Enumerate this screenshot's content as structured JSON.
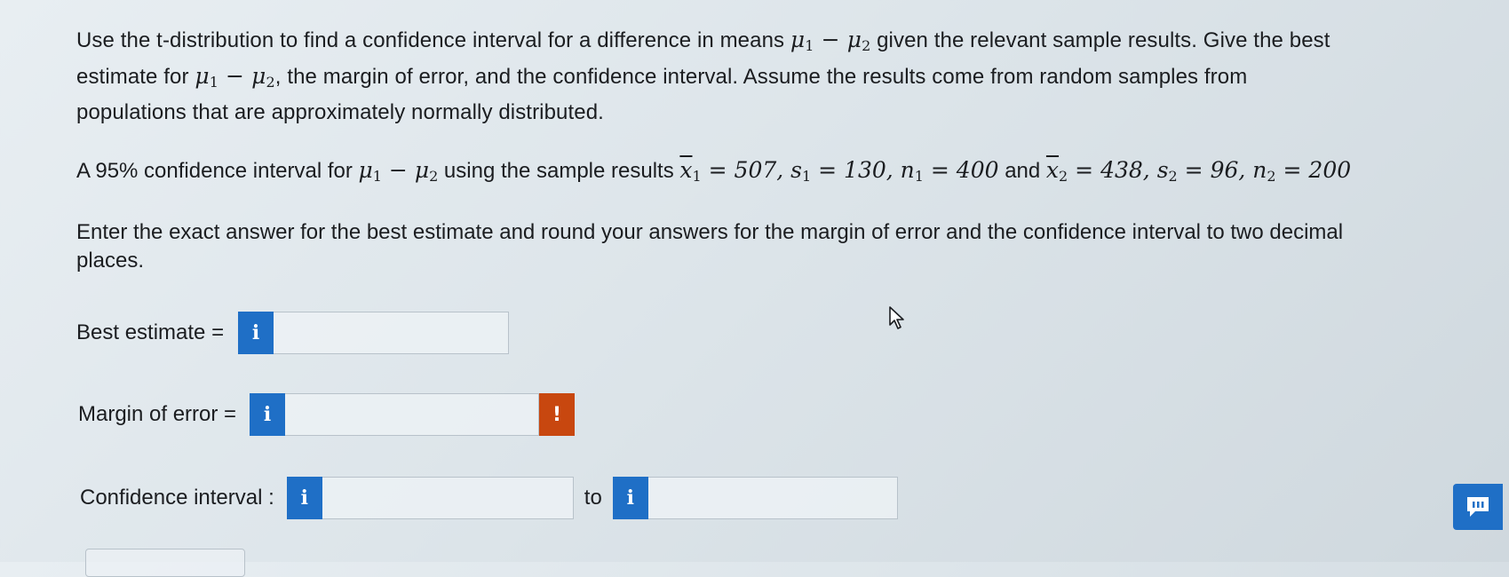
{
  "question": {
    "p1_line1_a": "Use the t-distribution to find a confidence interval for a difference in means ",
    "p1_line1_b": " given the relevant sample results. Give the best",
    "p1_line2_a": "estimate for ",
    "p1_line2_b": ", the margin of error, and the confidence interval. Assume the results come from random samples from",
    "p1_line3": "populations that are approximately normally distributed.",
    "mu": "μ",
    "minus": " − ",
    "p2_a": "A 95% confidence interval for ",
    "p2_b": " using the sample results ",
    "x1_eq": "= 507, ",
    "s1_eq": "= 130, ",
    "n1_eq": "= 400",
    "and": " and ",
    "x2_eq": "= 438, ",
    "s2_eq": "= 96, ",
    "n2_eq": "= 200",
    "x": "x",
    "s": "s",
    "n": "n",
    "one": "1",
    "two": "2",
    "p3": "Enter the exact answer for the best estimate and round your answers for the margin of error and the confidence interval to two decimal places."
  },
  "fields": {
    "best_estimate_label": "Best estimate =",
    "best_estimate_value": "",
    "margin_label": "Margin of error =",
    "margin_value": "",
    "ci_label": "Confidence interval :",
    "ci_lower_value": "",
    "to_label": "to",
    "ci_upper_value": ""
  },
  "icons": {
    "info": "i",
    "warning": "!",
    "info_icon_name": "info-icon",
    "warning_icon_name": "warning-icon",
    "chat_icon_name": "chat-icon"
  },
  "colors": {
    "info_blue": "#1f6fc6",
    "warning_orange": "#c8470f"
  }
}
